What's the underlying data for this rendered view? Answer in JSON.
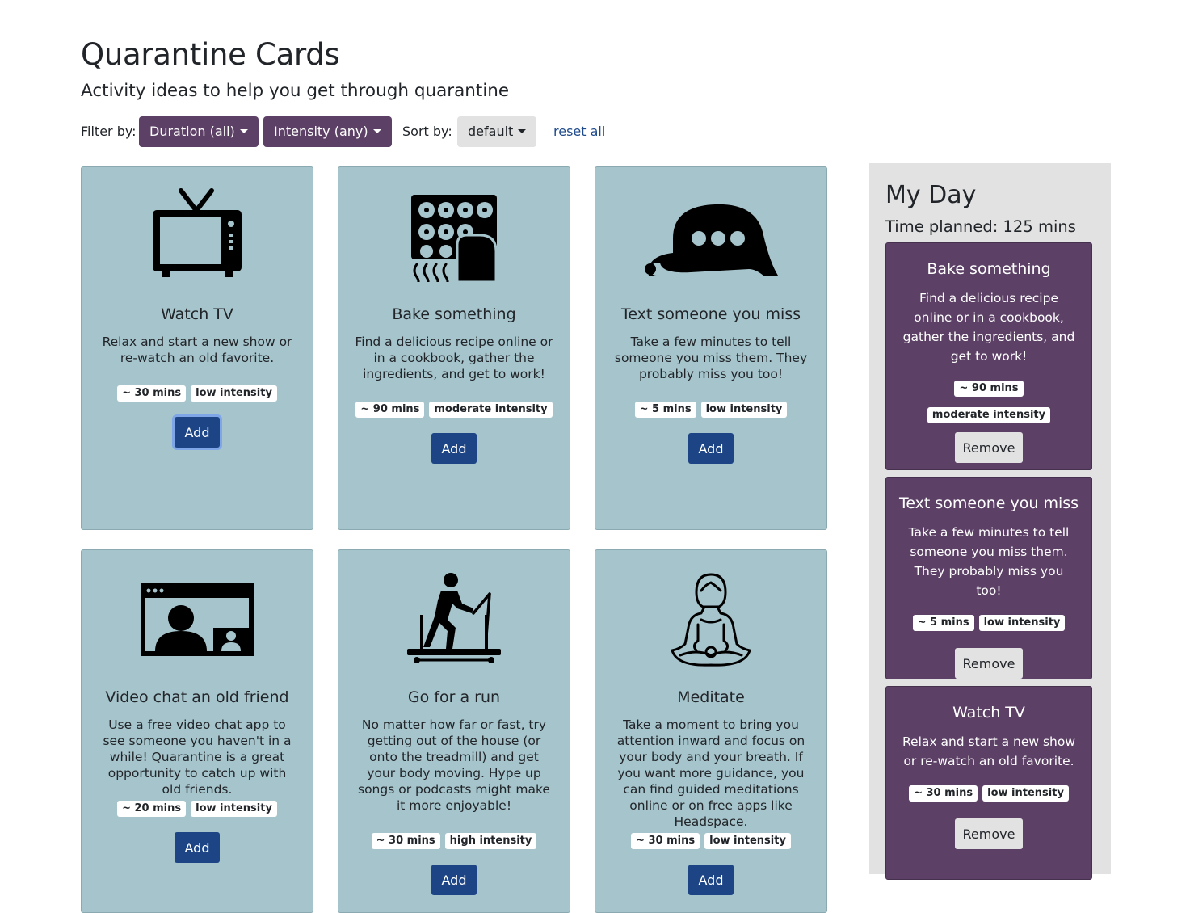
{
  "header": {
    "title": "Quarantine Cards",
    "subtitle": "Activity ideas to help you get through quarantine"
  },
  "toolbar": {
    "filter_label": "Filter by:",
    "duration_dropdown": "Duration (all)",
    "intensity_dropdown": "Intensity (any)",
    "sort_label": "Sort by:",
    "sort_dropdown": "default",
    "reset_link": "reset all"
  },
  "cards": [
    {
      "title": "Watch TV",
      "description": "Relax and start a new show or re-watch an old favorite.",
      "duration": "~ 30 mins",
      "intensity": "low intensity",
      "button": "Add",
      "icon": "tv-icon"
    },
    {
      "title": "Bake something",
      "description": "Find a delicious recipe online or in a cookbook, gather the ingredients, and get to work!",
      "duration": "~ 90 mins",
      "intensity": "moderate intensity",
      "button": "Add",
      "icon": "oven-icon"
    },
    {
      "title": "Text someone you miss",
      "description": "Take a few minutes to tell someone you miss them. They probably miss you too!",
      "duration": "~ 5 mins",
      "intensity": "low intensity",
      "button": "Add",
      "icon": "chat-bubble-icon"
    },
    {
      "title": "Video chat an old friend",
      "description": "Use a free video chat app to see someone you haven't in a while! Quarantine is a great opportunity to catch up with old friends.",
      "duration": "~ 20 mins",
      "intensity": "low intensity",
      "button": "Add",
      "icon": "video-chat-icon"
    },
    {
      "title": "Go for a run",
      "description": "No matter how far or fast, try getting out of the house (or onto the treadmill) and get your body moving. Hype up songs or podcasts might make it more enjoyable!",
      "duration": "~ 30 mins",
      "intensity": "high intensity",
      "button": "Add",
      "icon": "treadmill-icon"
    },
    {
      "title": "Meditate",
      "description": "Take a moment to bring you attention inward and focus on your body and your breath. If you want more guidance, you can find guided meditations online or on free apps like Headspace.",
      "duration": "~ 30 mins",
      "intensity": "low intensity",
      "button": "Add",
      "icon": "meditation-icon"
    }
  ],
  "my_day": {
    "title": "My Day",
    "time_planned": "Time planned: 125 mins",
    "items": [
      {
        "title": "Bake something",
        "description": "Find a delicious recipe online or in a cookbook, gather the ingredients, and get to work!",
        "duration": "~ 90 mins",
        "intensity": "moderate intensity",
        "button": "Remove"
      },
      {
        "title": "Text someone you miss",
        "description": "Take a few minutes to tell someone you miss them. They probably miss you too!",
        "duration": "~ 5 mins",
        "intensity": "low intensity",
        "button": "Remove"
      },
      {
        "title": "Watch TV",
        "description": "Relax and start a new show or re-watch an old favorite.",
        "duration": "~ 30 mins",
        "intensity": "low intensity",
        "button": "Remove"
      }
    ]
  },
  "colors": {
    "card_bg": "#a6c4cb",
    "accent_purple": "#5c4066",
    "button_blue": "#1d4585",
    "panel_gray": "#e2e2e2"
  }
}
